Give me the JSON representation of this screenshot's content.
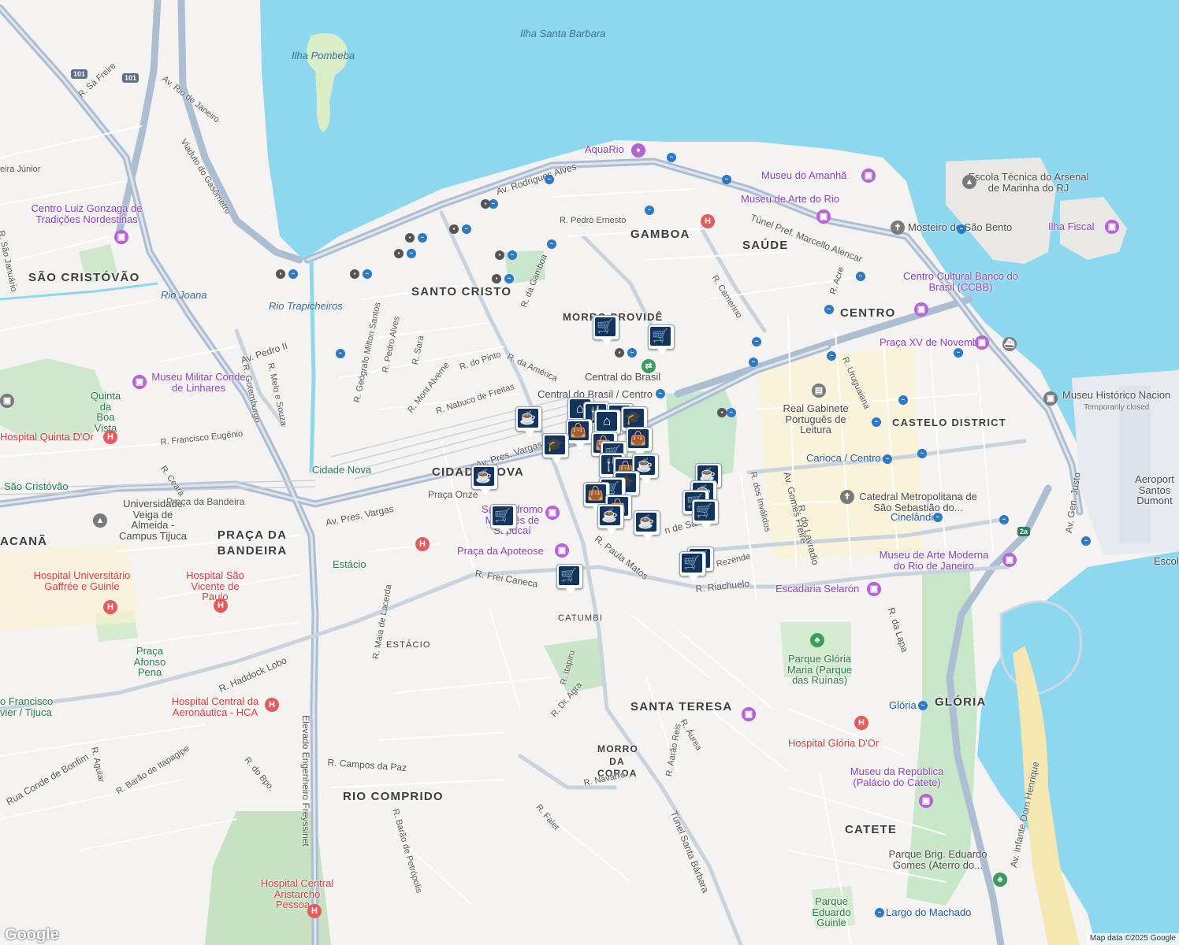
{
  "map": {
    "water_labels": [
      "Ilha Santa Barbara",
      "Ilha Pombeba",
      "Rio Joana",
      "Rio Trapicheiros"
    ],
    "districts": [
      "GAMBOA",
      "SAÚDE",
      "SANTO CRISTO",
      "CENTRO",
      "SÃO CRISTÓVÃO",
      "MORRO PROVIDÊ",
      "CIDADE NOVA",
      "CASTELO DISTRICT",
      "PRAÇA DA BANDEIRA",
      "CATUMBI",
      "ESTÁCIO",
      "SANTA TERESA",
      "MORRO DA COROA",
      "GLÓRIA",
      "RIO COMPRIDO",
      "CATETE",
      "ACANÃ"
    ],
    "streets": [
      "Av. Rio de Janeiro",
      "R. Sá Freire",
      "Viaduto do Gasômetro",
      "Av. Rodrigues Alves",
      "R. Pedro Ernesto",
      "Túnel Pref. Marcello Alencar",
      "R. Camerino",
      "R. Acre",
      "R. da Gamboa",
      "Av. Pedro II",
      "R. Melo e Souza",
      "R. Gotemburgo",
      "R. Geógrafo Milton Santos",
      "R. Pedro Alves",
      "R. Sara",
      "R. Mont Alverne",
      "R. do Pinto",
      "R. da América",
      "R. Nabuco de Freitas",
      "R. Francisco Eugênio",
      "R. Ceará",
      "Av. Pres. Vargas",
      "R. Uruguaiana",
      "R. dos Inválidos",
      "Av. Gomes Freire",
      "R. do Lavradio",
      "R. Paula Matos",
      "R. Riachuelo",
      "R. Frei Caneca",
      "R. Maia de Lacerda",
      "R. Haddock Lobo",
      "R. Itapiru",
      "R. Dr. Agra",
      "R. Campos da Paz",
      "R. Navarro",
      "R. Aarão Reis",
      "R. Áurea",
      "R. Barão de Itapagipe",
      "R. Aguiar",
      "R. do Bpo.",
      "Rua Conde de Bonfim",
      "R. Barão de Petrópolis",
      "R. Falet",
      "Túnel Santa Bárbara",
      "Elevado Engenheiro Freyssinet",
      "R. da Lapa",
      "Av. Infante Dom Henrique",
      "Av. Gen. Justo",
      "Rezende",
      "n de Sa",
      "Praça Onze",
      "Praça da Bandeira",
      "Av. Pres. Vargas"
    ],
    "pois": {
      "aquario": "AquaRio",
      "museu_amanha": "Museu do Amanhã",
      "museu_arte_rio": "Museu de Arte do Rio",
      "escola_tecnica": "Escola Técnica do Arsenal de Marinha do RJ",
      "mosteiro": "Mosteiro de São Bento",
      "ilha_fiscal": "Ilha Fiscal",
      "ccbb": "Centro Cultural Banco do Brasil (CCBB)",
      "praca_xv": "Praça XV de Novembro",
      "museu_historico": "Museu Histórico Nacion",
      "museu_historico_status": "Temporarily closed",
      "central_brasil": "Central do Brasil",
      "central_brasil_centro": "Central do Brasil / Centro",
      "real_gabinete": "Real Gabinete Português de Leitura",
      "carioca": "Carioca / Centro",
      "catedral": "Catedral Metropolitana de São Sebastião do...",
      "cinelandia": "Cinelândia",
      "aeroporto": "Aeroport Santos Dumont",
      "escol": "Escol",
      "mam": "Museu de Arte Moderna do Rio de Janeiro",
      "escadaria": "Escadaria Selarón",
      "parque_gloria": "Parque Glória Maria (Parque das Ruínas)",
      "gloria_station": "Glória",
      "hospital_gloria": "Hospital Glória D'Or",
      "museu_republica": "Museu da República (Palácio do Catete)",
      "parque_brig": "Parque Brig. Eduardo Gomes (Aterro do...",
      "largo_machado": "Largo do Machado",
      "parque_guinle": "Parque Eduardo Guinle",
      "centro_luiz": "Centro Luiz Gonzaga de Tradições Nordestinas",
      "museu_militar": "Museu Militar Conde de Linhares",
      "quinta": "Quinta da Boa Vista",
      "hospital_quinta": "Hospital Quinta D'Or",
      "sao_cristovao_st": "São Cristóvão",
      "cidade_nova_st": "Cidade Nova",
      "univ_veiga": "Universidade Veiga de Almeida - Campus Tijuca",
      "hospital_gaffree": "Hospital Universitário Gaffrée e Guinle",
      "hospital_sao_vicente": "Hospital São Vicente de Paulo",
      "praca_afonso": "Praça Afonso Pena",
      "hospital_aeronautica": "Hospital Central da Aeronáutica - HCA",
      "sambodromo": "Sambódromo Marquês de Sapucaí",
      "praca_apoteose": "Praça da Apoteose",
      "estacio_st": "Estácio",
      "santa_teresa": "SANTA TERESA",
      "hospital_aristarcho": "Hospital Central Aristarcho Pessoa...",
      "sao_francisco": "o Francisco vier / Tijuca",
      "junior": "eira Júnior",
      "sao_januario": "R. São Januário"
    },
    "shields": [
      "101",
      "101",
      "2a"
    ],
    "icons": [
      "coffee-icon",
      "cart-icon",
      "shopping-bag-icon",
      "restaurant-icon",
      "school-icon",
      "bank-icon"
    ],
    "brand": "Google",
    "attribution": "Map data ©2025 Google",
    "colors": {
      "water": "#8ed8ef",
      "land": "#f5f3f1",
      "park": "#c7e6cb",
      "highway": "#9fb4cc",
      "pin": "#13345e"
    }
  }
}
